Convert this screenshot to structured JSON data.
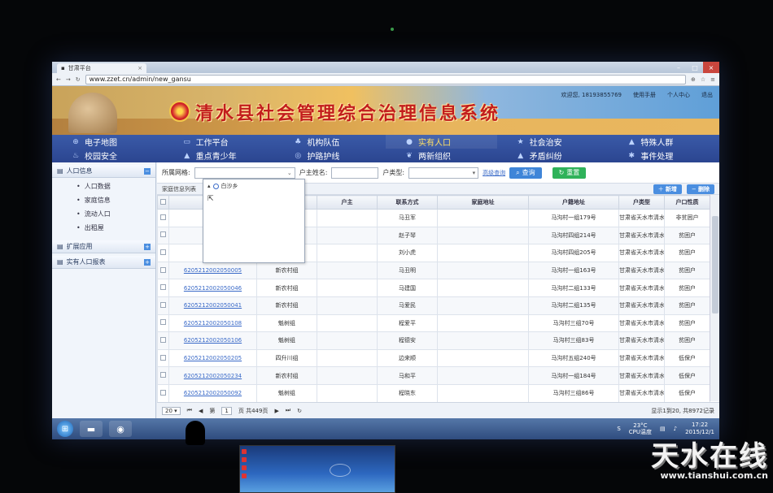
{
  "browser": {
    "tab_title": "甘肃平台",
    "url": "www.zzet.cn/admin/new_gansu"
  },
  "header": {
    "system_title": "清水县社会管理综合治理信息系统",
    "welcome": "欢迎您, 18193855769",
    "manual": "使用手册",
    "profile": "个人中心",
    "logout": "退出"
  },
  "nav": [
    {
      "label": "电子地图",
      "icon": "globe-icon",
      "glyph": "⊕"
    },
    {
      "label": "工作平台",
      "icon": "monitor-icon",
      "glyph": "▭"
    },
    {
      "label": "机构队伍",
      "icon": "group-icon",
      "glyph": "♣"
    },
    {
      "label": "实有人口",
      "icon": "person-icon",
      "glyph": "●",
      "active": true
    },
    {
      "label": "社会治安",
      "icon": "star-icon",
      "glyph": "★"
    },
    {
      "label": "特殊人群",
      "icon": "warning-icon",
      "glyph": "▲"
    },
    {
      "label": "校园安全",
      "icon": "school-icon",
      "glyph": "♨"
    },
    {
      "label": "重点青少年",
      "icon": "warning-icon",
      "glyph": "▲"
    },
    {
      "label": "护路护线",
      "icon": "target-icon",
      "glyph": "◎"
    },
    {
      "label": "两新组织",
      "icon": "flower-icon",
      "glyph": "❦"
    },
    {
      "label": "矛盾纠纷",
      "icon": "warning-icon",
      "glyph": "▲"
    },
    {
      "label": "事件处理",
      "icon": "gear-icon",
      "glyph": "✱"
    }
  ],
  "sidebar": {
    "sections": [
      {
        "label": "人口信息",
        "toggle": "−",
        "items": [
          "人口数据",
          "家庭信息",
          "流动人口",
          "出租屋"
        ]
      },
      {
        "label": "扩展应用",
        "toggle": "+",
        "items": []
      },
      {
        "label": "实有人口报表",
        "toggle": "+",
        "items": []
      }
    ]
  },
  "filter": {
    "grid_label": "所属网格:",
    "owner_label": "户主姓名:",
    "type_label": "户类型:",
    "advanced": "高级查询",
    "query": "查询",
    "reset": "重置"
  },
  "dropdown": {
    "node": "白沙乡"
  },
  "list": {
    "title": "家庭信息列表",
    "add": "新增",
    "delete": "删除"
  },
  "table": {
    "headers": [
      "",
      "家庭",
      "",
      "户主",
      "联系方式",
      "家庭地址",
      "户籍地址",
      "户类型",
      "户口性质"
    ],
    "rows": [
      [
        "",
        "",
        "马丑军",
        "",
        "马沟村一组179号",
        "甘肃省天水市清水县白沙乡马",
        "非贫困户",
        "农村户籍"
      ],
      [
        "",
        "",
        "赵子琴",
        "",
        "马沟村四组214号",
        "甘肃省天水市清水县白沙乡马",
        "贫困户",
        "农村户籍"
      ],
      [
        "",
        "",
        "刘小虎",
        "",
        "马沟村四组205号",
        "甘肃省天水市清水县白沙乡马",
        "贫困户",
        "农村户籍"
      ],
      [
        "620521200205000​5",
        "新农村组",
        "马丑明",
        "",
        "马沟村一组163号",
        "甘肃省天水市清水县白沙乡马",
        "贫困户",
        "农村户籍"
      ],
      [
        "620521200205004​6",
        "新农村组",
        "马建国",
        "",
        "马沟村二组133号",
        "甘肃省天水市清水县白沙乡马",
        "贫困户",
        "农村户籍"
      ],
      [
        "620521200205004​1",
        "新农村组",
        "马爱民",
        "",
        "马沟村二组135号",
        "甘肃省天水市清水县白沙乡马",
        "贫困户",
        "农村户籍"
      ],
      [
        "620521200205010​8",
        "魁树组",
        "程爱平",
        "",
        "马沟村三组70号",
        "甘肃省天水市清水县白沙乡马",
        "贫困户",
        "农村户籍"
      ],
      [
        "620521200205010​6",
        "魁树组",
        "程德安",
        "",
        "马沟村三组83号",
        "甘肃省天水市清水县白沙乡马",
        "贫困户",
        "农村户籍"
      ],
      [
        "620521200205020​5",
        "四升川组",
        "边来顺",
        "",
        "马沟村五组240号",
        "甘肃省天水市清水县白沙乡马",
        "低保户",
        "农村户籍"
      ],
      [
        "620521200205023​4",
        "新农村组",
        "马和平",
        "",
        "马沟村一组184号",
        "甘肃省天水市清水县白沙乡马",
        "低保户",
        "农村户籍"
      ],
      [
        "620521200205009​2",
        "魁树组",
        "程晓东",
        "",
        "马沟村三组86号",
        "甘肃省天水市清水县白沙乡马",
        "低保户",
        "农村户籍"
      ]
    ]
  },
  "pager": {
    "page_size": "20",
    "page_prefix": "第",
    "page": "1",
    "total_pages": "页 共449页",
    "info": "显示1到20, 共8972记录"
  },
  "taskbar": {
    "temp": "23°C",
    "cpu": "CPU温度",
    "time": "17:22",
    "date": "2015/12/1"
  },
  "watermark": {
    "title": "天水在线",
    "url": "www.tianshui.com.cn"
  }
}
